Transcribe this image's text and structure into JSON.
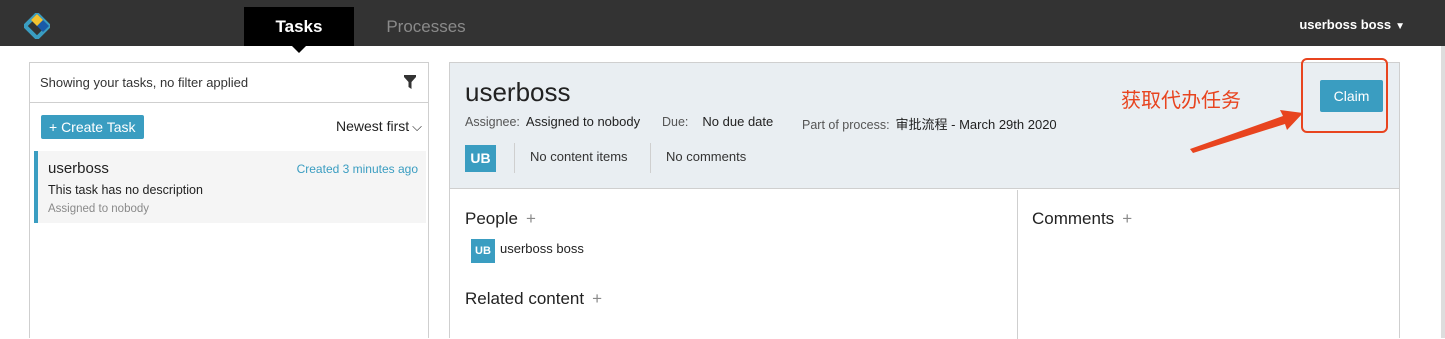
{
  "nav": {
    "tabs": [
      {
        "label": "Tasks",
        "active": true
      },
      {
        "label": "Processes",
        "active": false
      }
    ],
    "user_menu": "userboss boss",
    "logo_icon": "diamond-logo-icon",
    "accent_color": "#3a9dc1"
  },
  "left_panel": {
    "filter_text": "Showing your tasks, no filter applied",
    "create_task_label": "+ Create Task",
    "sort_label": "Newest first",
    "tasks": [
      {
        "name": "userboss",
        "created": "Created 3 minutes ago",
        "description": "This task has no description",
        "assigned": "Assigned to nobody"
      }
    ]
  },
  "task_detail": {
    "title": "userboss",
    "assignee_label": "Assignee:",
    "assignee_value": "Assigned to nobody",
    "due_label": "Due:",
    "due_value": "No due date",
    "process_label": "Part of process:",
    "process_value": "审批流程 - March 29th 2020",
    "avatar_initials": "UB",
    "content_items": "No content items",
    "comments_count": "No comments",
    "claim_label": "Claim",
    "people_title": "People",
    "people": [
      {
        "initials": "UB",
        "name": "userboss boss"
      }
    ],
    "related_title": "Related content",
    "comments_title": "Comments"
  },
  "annotation": {
    "text": "获取代办任务",
    "color": "#e8441f"
  }
}
